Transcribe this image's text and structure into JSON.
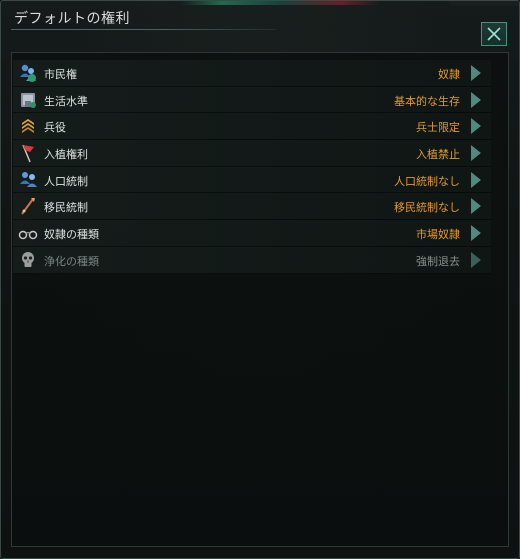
{
  "window": {
    "title": "デフォルトの権利"
  },
  "rights": [
    {
      "label": "市民権",
      "value": "奴隷",
      "icon": "citizens-icon"
    },
    {
      "label": "生活水準",
      "value": "基本的な生存",
      "icon": "living-standard-icon"
    },
    {
      "label": "兵役",
      "value": "兵士限定",
      "icon": "military-rank-icon"
    },
    {
      "label": "入植権利",
      "value": "入植禁止",
      "icon": "colony-flag-icon"
    },
    {
      "label": "人口統制",
      "value": "人口統制なし",
      "icon": "population-icon"
    },
    {
      "label": "移民統制",
      "value": "移民統制なし",
      "icon": "migration-icon"
    },
    {
      "label": "奴隷の種類",
      "value": "市場奴隷",
      "icon": "shackles-icon"
    },
    {
      "label": "浄化の種類",
      "value": "強制退去",
      "icon": "skull-icon",
      "disabled": true
    }
  ],
  "colors": {
    "value_text": "#e29a2e",
    "arrow": "#4e8a7e",
    "close_button": "#4b8e82"
  }
}
